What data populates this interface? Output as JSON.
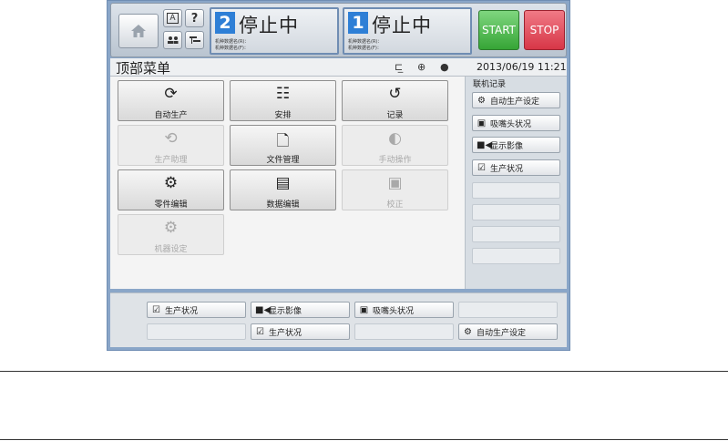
{
  "header": {
    "icons": {
      "home": "home-icon",
      "a": "A",
      "help": "?",
      "users": "users-icon",
      "network": "network-icon"
    },
    "lanes": [
      {
        "number": "2",
        "state": "停止中",
        "prog_r": "机种数据名(R)：",
        "prog_f": "机种数据名(F)："
      },
      {
        "number": "1",
        "state": "停止中",
        "prog_r": "机种数据名(R)：",
        "prog_f": "机种数据名(F)："
      }
    ],
    "start_label": "START",
    "stop_label": "STOP"
  },
  "titlebar": {
    "title": "顶部菜单",
    "datetime": "2013/06/19 11:21"
  },
  "menu": {
    "tiles": [
      {
        "icon": "⟳",
        "label": "自动生产",
        "enabled": true
      },
      {
        "icon": "☷",
        "label": "安排",
        "enabled": true
      },
      {
        "icon": "↺",
        "label": "记录",
        "enabled": true
      },
      {
        "icon": "⟲",
        "label": "生产助理",
        "enabled": false
      },
      {
        "icon": "🗋",
        "label": "文件管理",
        "enabled": true
      },
      {
        "icon": "◐",
        "label": "手动操作",
        "enabled": false
      },
      {
        "icon": "⚙",
        "label": "零件编辑",
        "enabled": true
      },
      {
        "icon": "▤",
        "label": "数据编辑",
        "enabled": true
      },
      {
        "icon": "▣",
        "label": "校正",
        "enabled": false
      },
      {
        "icon": "⚙",
        "label": "机器设定",
        "enabled": false
      }
    ]
  },
  "right_panel": {
    "title": "联机记录",
    "buttons": [
      {
        "icon": "⚙",
        "label": "自动生产设定"
      },
      {
        "icon": "▣",
        "label": "吸嘴头状况"
      },
      {
        "icon": "■◀",
        "label": "显示影像"
      },
      {
        "icon": "☑",
        "label": "生产状况"
      }
    ]
  },
  "bottom": {
    "row1": [
      {
        "icon": "☑",
        "label": "生产状况"
      },
      {
        "icon": "■◀",
        "label": "显示影像"
      },
      {
        "icon": "▣",
        "label": "吸嘴头状况"
      }
    ],
    "row2_mid": {
      "icon": "☑",
      "label": "生产状况"
    },
    "row2_right": {
      "icon": "⚙",
      "label": "自动生产设定"
    }
  }
}
